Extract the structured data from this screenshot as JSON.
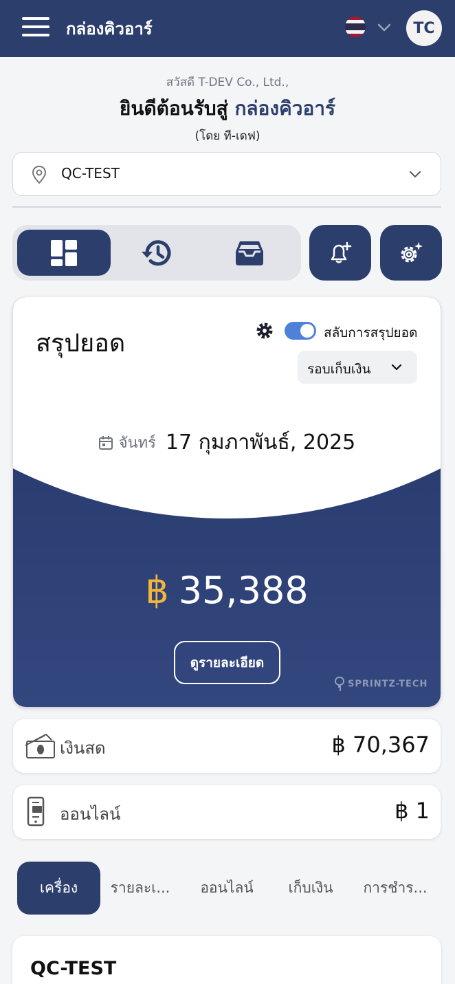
{
  "header": {
    "app_title": "กล่องคิวอาร์",
    "avatar_initials": "TC",
    "language_flag": "thailand-flag-icon"
  },
  "greeting": {
    "hello": "สวัสดี T-DEV Co., Ltd.,",
    "welcome_prefix": "ยินดีต้อนรับสู่ ",
    "welcome_brand": "กล่องคิวอาร์",
    "byline": "(โดย ที-เดฟ)"
  },
  "location": {
    "selected": "QC-TEST",
    "icon": "map-pin-icon"
  },
  "view_tabs": [
    {
      "icon": "dashboard-icon",
      "active": true
    },
    {
      "icon": "history-icon",
      "active": false
    },
    {
      "icon": "inbox-icon",
      "active": false
    }
  ],
  "action_buttons": [
    {
      "icon": "bell-plus-icon"
    },
    {
      "icon": "settings-sparkle-icon"
    }
  ],
  "summary": {
    "title": "สรุปยอด",
    "toggle_label": "สลับการสรุปยอด",
    "toggle_on": true,
    "cycle_select": "รอบเก็บเงิน",
    "date_day": "จันทร์",
    "date_full": "17  กุมภาพันธ์, 2025",
    "currency_symbol": "฿",
    "total": "35,388",
    "detail_button": "ดูรายละเอียด",
    "watermark": "SPRINTZ-TECH"
  },
  "payments": [
    {
      "label": "เงินสด",
      "amount": "฿ 70,367",
      "icon": "cash-icon"
    },
    {
      "label": "ออนไลน์",
      "amount": "฿ 1",
      "icon": "mobile-payment-icon"
    }
  ],
  "bottom_tabs": [
    {
      "label": "เครื่อง",
      "active": true
    },
    {
      "label": "รายละเ...",
      "active": false
    },
    {
      "label": "ออนไลน์",
      "active": false
    },
    {
      "label": "เก็บเงิน",
      "active": false
    },
    {
      "label": "การชำร...",
      "active": false
    }
  ],
  "device_card": {
    "name": "QC-TEST"
  },
  "colors": {
    "primary": "#2c3e6b",
    "accent_gold": "#f2b63c",
    "toggle_blue": "#4e82d8",
    "background": "#f4f5f7"
  }
}
